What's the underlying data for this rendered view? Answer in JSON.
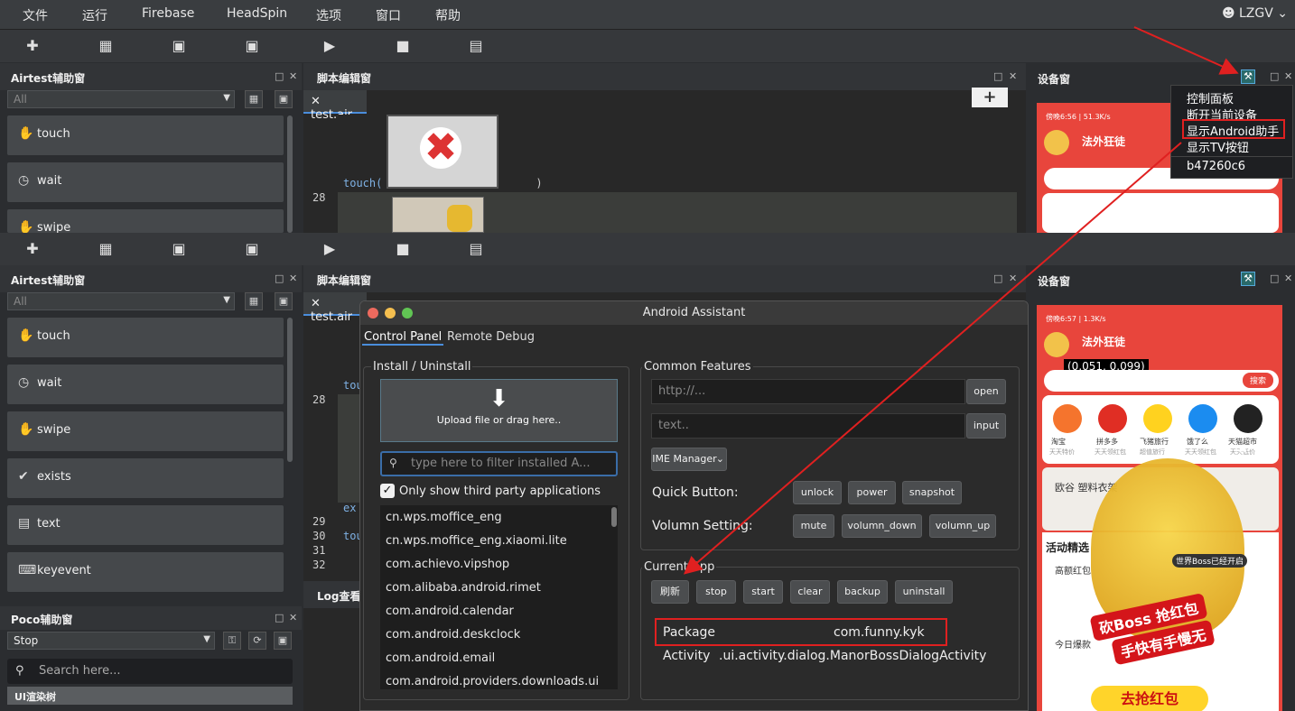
{
  "menubar": {
    "items": [
      "文件",
      "运行",
      "Firebase",
      "HeadSpin",
      "选项",
      "窗口",
      "帮助"
    ],
    "user": "LZGV"
  },
  "toolbar": {
    "icons": [
      "add-icon",
      "open-folder-icon",
      "save-icon",
      "save-as-icon",
      "run-icon",
      "stop-icon",
      "log-icon"
    ]
  },
  "airtest": {
    "title": "Airtest辅助窗",
    "combo": "All",
    "commands_top": [
      "touch",
      "wait",
      "swipe"
    ],
    "commands_bottom": [
      "touch",
      "wait",
      "swipe",
      "exists",
      "text",
      "keyevent"
    ]
  },
  "script": {
    "title": "脚本编辑窗",
    "tab": "test.air",
    "top_lines": [
      "28"
    ],
    "top_code": "touch(",
    "bottom_lines": [
      "28",
      "29",
      "30",
      "31",
      "32"
    ],
    "bottom_code": [
      "tou",
      "ex",
      "tou"
    ],
    "log_title": "Log查看"
  },
  "poco": {
    "title": "Poco辅助窗",
    "combo": "Stop",
    "search_placeholder": "Search here...",
    "tree_label": "UI渲染树"
  },
  "device": {
    "title": "设备窗",
    "phone_status_top": "傍晚6:56 | 51.3K/s",
    "phone_status_bottom": "傍晚6:57 | 1.3K/s",
    "shop_name": "法外狂徒",
    "coord_readout": "(0.051, 0.099)",
    "search_button": "搜索",
    "app_icons": [
      {
        "label": "淘宝",
        "sub": "天天特价"
      },
      {
        "label": "拼多多",
        "sub": "天天领红包"
      },
      {
        "label": "飞猪旅行",
        "sub": "超值旅行"
      },
      {
        "label": "饿了么",
        "sub": "天天领红包"
      },
      {
        "label": "天猫超市",
        "sub": "天天低价"
      }
    ],
    "banner_text": "欧谷 塑料衣架",
    "section": "活动精选",
    "hot_label": "高额红包",
    "today_label": "今日爆款",
    "boss_text_1": "砍Boss 抢红包",
    "boss_text_2": "手快有手慢无",
    "boss_notice": "世界Boss已经开启",
    "grab_button": "去抢红包"
  },
  "popup": {
    "items": [
      "控制面板",
      "断开当前设备",
      "显示Android助手",
      "显示TV按钮",
      "b47260c6"
    ]
  },
  "assistant": {
    "title": "Android Assistant",
    "tabs": [
      "Control Panel",
      "Remote Debug"
    ],
    "install_title": "Install / Uninstall",
    "upload_text": "Upload file or drag here..",
    "filter_placeholder": "type here to filter installed A...",
    "third_party_label": "Only show third party applications",
    "third_party_checked": true,
    "packages": [
      "cn.wps.moffice_eng",
      "cn.wps.moffice_eng.xiaomi.lite",
      "com.achievo.vipshop",
      "com.alibaba.android.rimet",
      "com.android.calendar",
      "com.android.deskclock",
      "com.android.email",
      "com.android.providers.downloads.ui"
    ],
    "common_title": "Common Features",
    "url_placeholder": "http://...",
    "open_button": "open",
    "text_placeholder": "text..",
    "input_button": "input",
    "ime_manager": "IME Manager",
    "quick_label": "Quick Button:",
    "quick_buttons": [
      "unlock",
      "power",
      "snapshot"
    ],
    "volume_label": "Volumn Setting:",
    "volume_buttons": [
      "mute",
      "volumn_down",
      "volumn_up"
    ],
    "current_title": "Current App",
    "current_buttons": [
      "刷新",
      "stop",
      "start",
      "clear",
      "backup",
      "uninstall"
    ],
    "package_label": "Package",
    "package_value": "com.funny.kyk",
    "activity_label": "Activity",
    "activity_value": ".ui.activity.dialog.ManorBossDialogActivity"
  },
  "colors": {
    "accent_red": "#e02020",
    "phone_red": "#e8453c",
    "selection": "#4a8ddc"
  }
}
